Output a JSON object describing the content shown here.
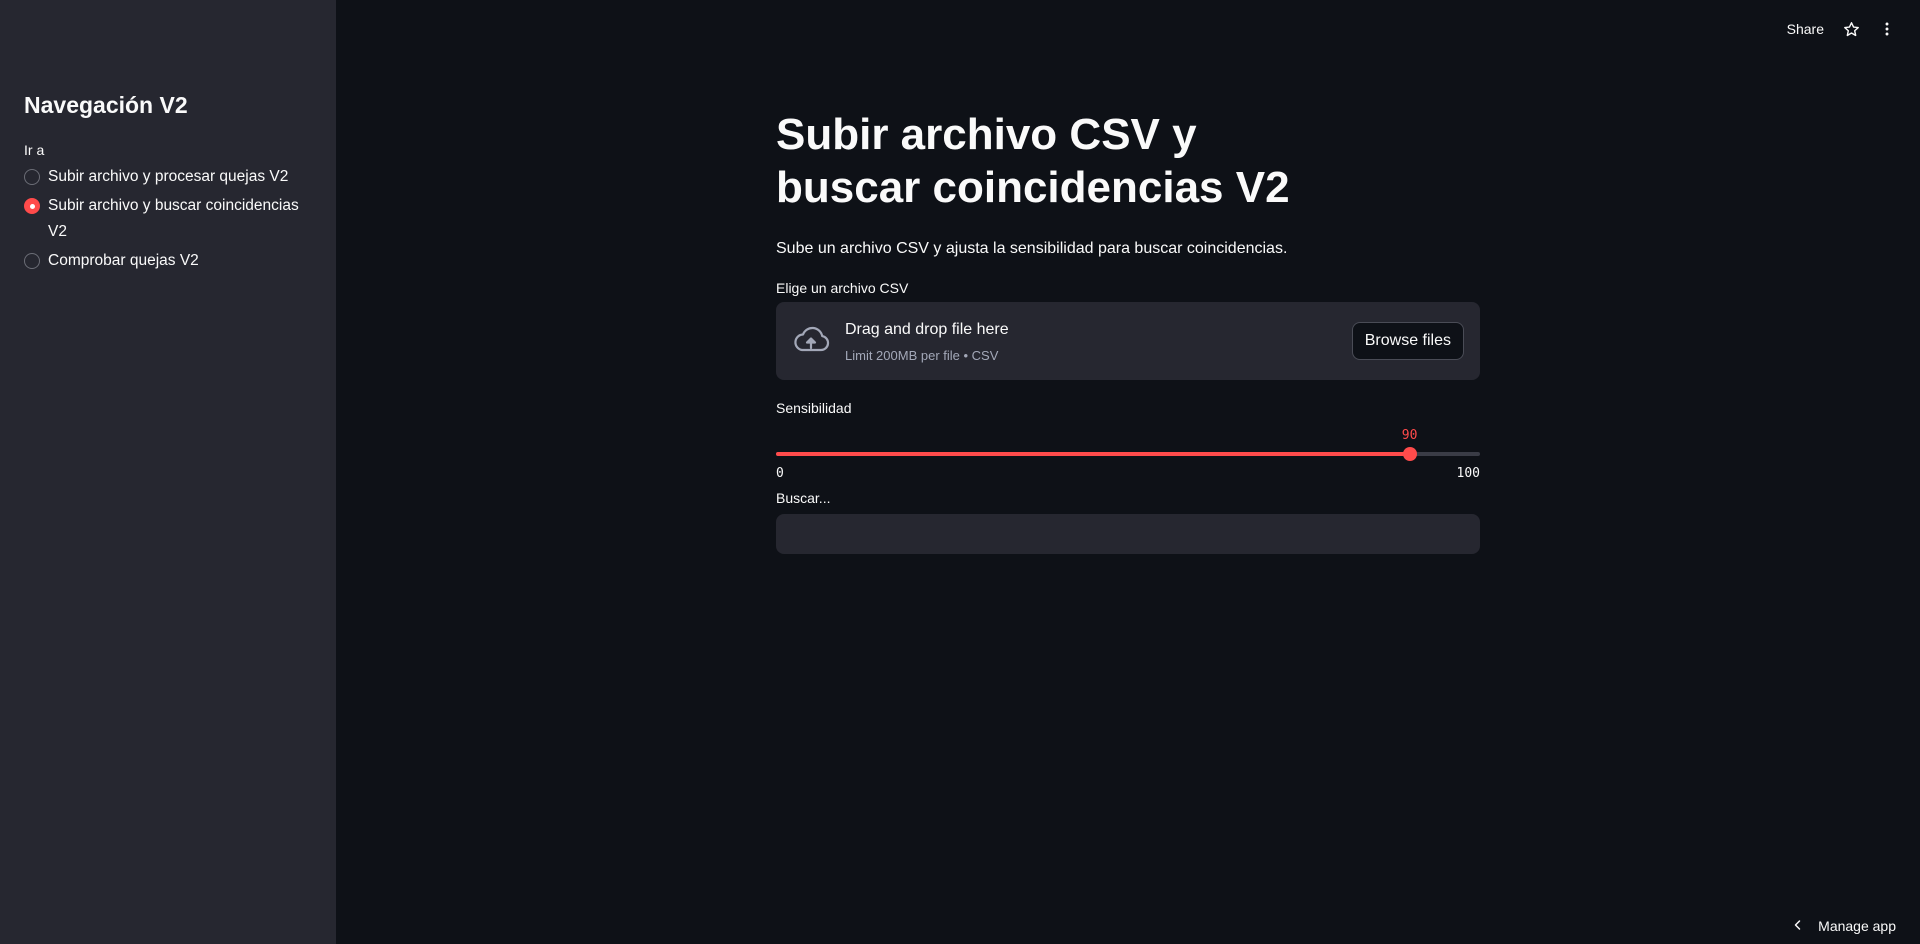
{
  "sidebar": {
    "title": "Navegación V2",
    "radio_label": "Ir a",
    "items": [
      {
        "label": "Subir archivo y procesar quejas V2",
        "selected": false
      },
      {
        "label": "Subir archivo y buscar coincidencias V2",
        "selected": true
      },
      {
        "label": "Comprobar quejas V2",
        "selected": false
      }
    ]
  },
  "header": {
    "share_label": "Share",
    "star_icon": "star-icon",
    "menu_icon": "more-vertical-icon"
  },
  "main": {
    "title": "Subir archivo CSV y buscar coincidencias V2",
    "description": "Sube un archivo CSV y ajusta la sensibilidad para buscar coincidencias.",
    "uploader": {
      "label": "Elige un archivo CSV",
      "drag_text": "Drag and drop file here",
      "limit_text": "Limit 200MB per file • CSV",
      "browse_label": "Browse files",
      "icon": "cloud-upload-icon"
    },
    "slider": {
      "label": "Sensibilidad",
      "value": 90,
      "min": 0,
      "max": 100
    },
    "search": {
      "label": "Buscar...",
      "value": "",
      "placeholder": ""
    }
  },
  "footer": {
    "manage_label": "Manage app"
  },
  "colors": {
    "accent": "#ff4b4b",
    "background": "#0e1117",
    "sidebar_bg": "#262730"
  }
}
